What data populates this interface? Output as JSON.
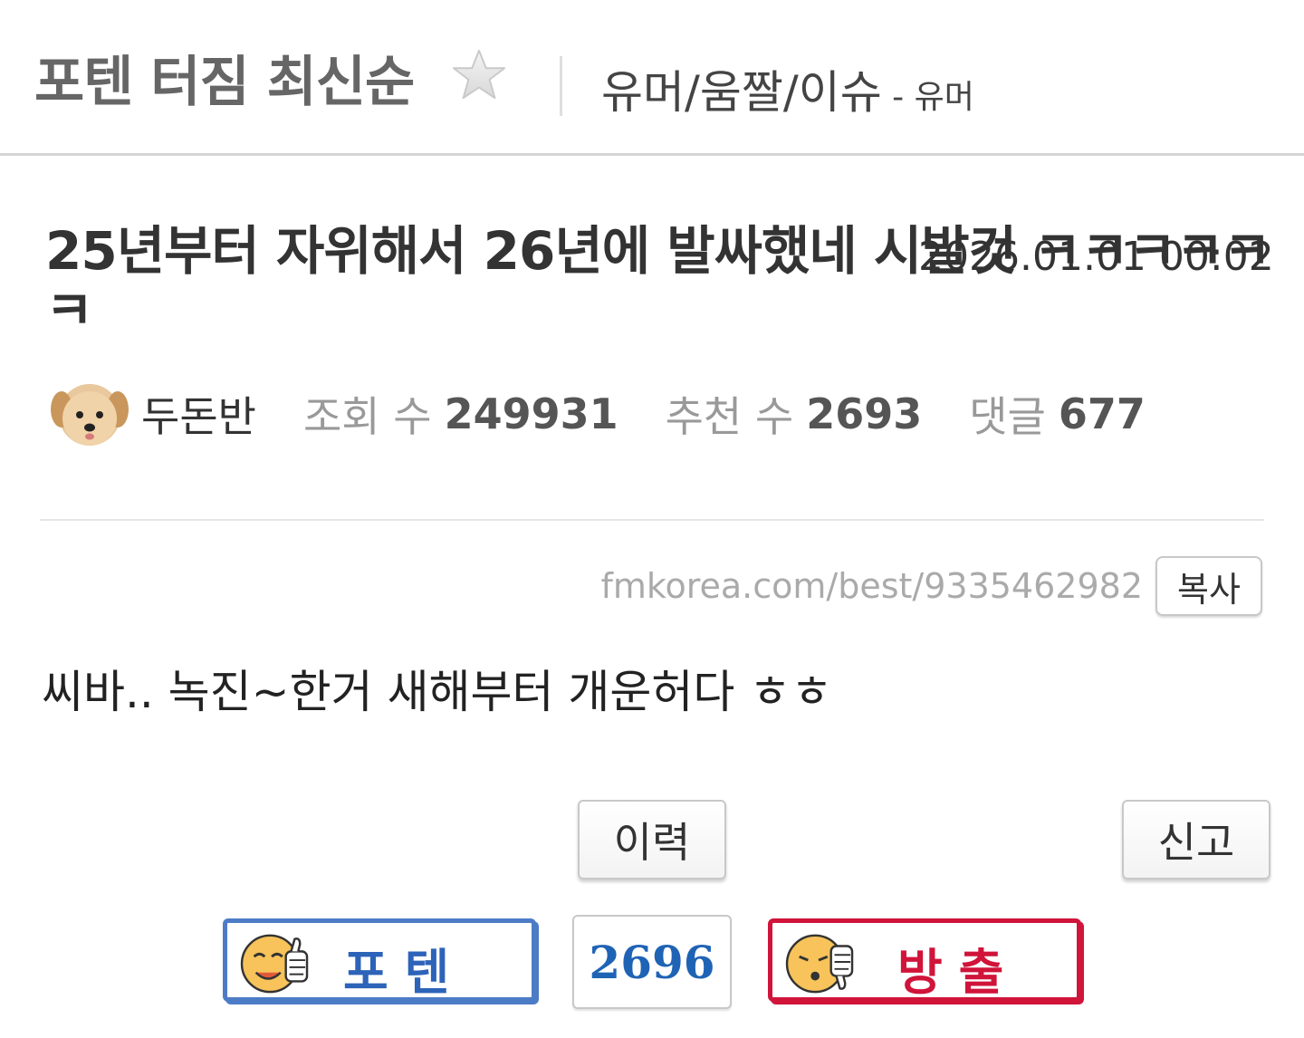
{
  "header": {
    "board_title": "포텐 터짐 최신순",
    "category": "유머/움짤/이슈",
    "sub_category": " - 유머"
  },
  "post": {
    "title": "25년부터 자위해서 26년에 발싸했네 시발것 ㅋㅋㅋㅋㅋㅋ",
    "date": "2026.01.01 00:02",
    "author": "두돈반",
    "views_label": "조회 수",
    "views": "249931",
    "recommend_label": "추천 수",
    "recommend": "2693",
    "comments_label": "댓글",
    "comments": "677",
    "url": "fmkorea.com/best/9335462982",
    "copy_label": "복사",
    "body": "씨바.. 녹진~한거 새해부터 개운허다 ㅎㅎ"
  },
  "actions": {
    "history_label": "이력",
    "report_label": "신고",
    "vote_up_label": "포텐",
    "vote_count": "2696",
    "vote_down_label": "방출"
  },
  "colors": {
    "vote_up": "#4d7cc7",
    "vote_down": "#d0143a",
    "vote_count": "#1f63b5"
  },
  "icons": {
    "favorite": "star-icon",
    "avatar": "puppy-avatar",
    "vote_up": "thumbs-up-face-icon",
    "vote_down": "thumbs-down-face-icon"
  }
}
